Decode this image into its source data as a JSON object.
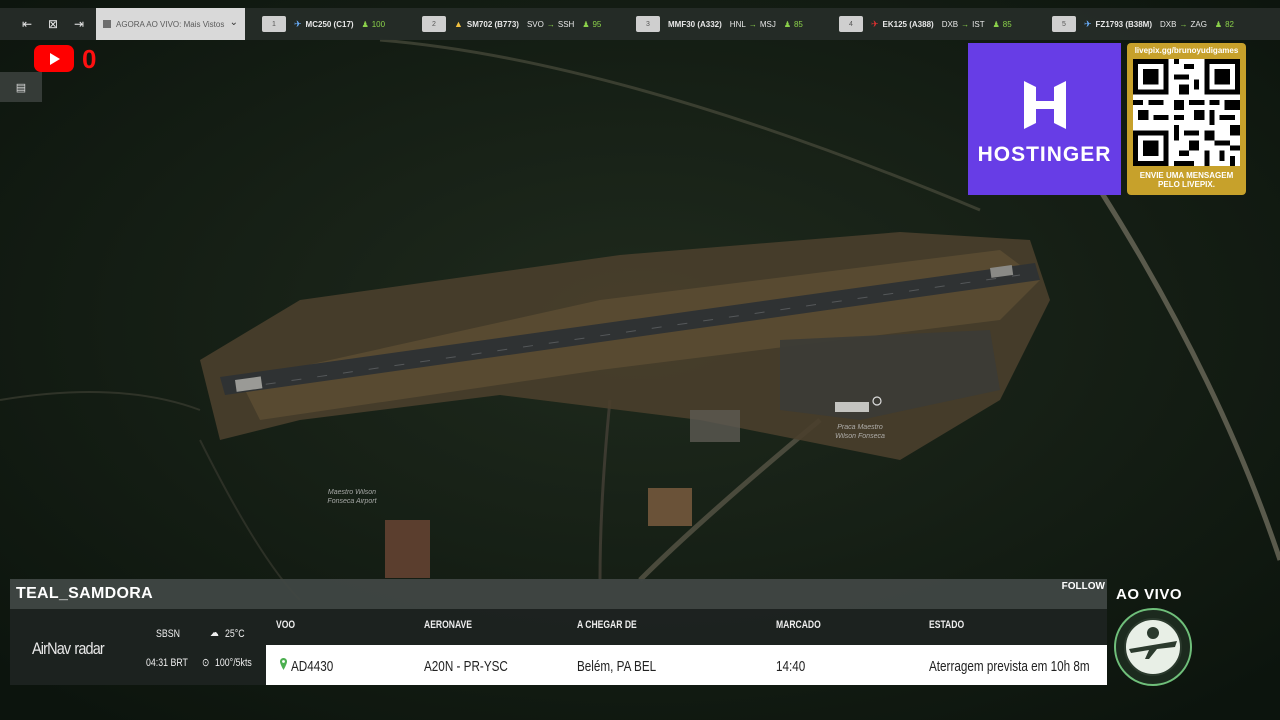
{
  "topbar": {
    "now_label": "AGORA AO VIVO: Mais Vistos",
    "flights": [
      {
        "rank": "1",
        "callsign": "MC250 (C17)",
        "route_from": "",
        "route_to": "",
        "score": "100"
      },
      {
        "rank": "2",
        "callsign": "SM702 (B773)",
        "route_from": "SVO",
        "route_to": "SSH",
        "score": "95"
      },
      {
        "rank": "3",
        "callsign": "MMF30 (A332)",
        "route_from": "HNL",
        "route_to": "MSJ",
        "score": "85"
      },
      {
        "rank": "4",
        "callsign": "EK125 (A388)",
        "route_from": "DXB",
        "route_to": "IST",
        "score": "85"
      },
      {
        "rank": "5",
        "callsign": "FZ1793 (B38M)",
        "route_from": "DXB",
        "route_to": "ZAG",
        "score": "82"
      }
    ]
  },
  "youtube": {
    "count": "0"
  },
  "map": {
    "airport_label_1": "Maestro Wilson",
    "airport_label_2": "Fonseca Airport",
    "plaza_label_1": "Praca Maestro",
    "plaza_label_2": "Wilson Fonseca"
  },
  "sponsor": {
    "name": "HOSTINGER",
    "qr_url": "livepix.gg/brunoyudigames",
    "qr_message_1": "ENVIE UMA MENSAGEM",
    "qr_message_2": "PELO LIVEPIX."
  },
  "panel": {
    "follow": "FOLLOW",
    "flight_name": "TEAL_SAMDORA",
    "brand_main": "AirNav",
    "brand_sub": "radar",
    "airport_code": "SBSN",
    "local_time": "04:31 BRT",
    "temperature": "25°C",
    "wind": "100°/5kts",
    "headers": {
      "flight": "VOO",
      "aircraft": "AERONAVE",
      "from": "A CHEGAR DE",
      "scheduled": "MARCADO",
      "status": "ESTADO"
    },
    "row": {
      "flight": "AD4430",
      "aircraft": "A20N - PR-YSC",
      "from": "Belém, PA BEL",
      "scheduled": "14:40",
      "status": "Aterragem prevista em 10h 8m"
    }
  },
  "live": {
    "label": "AO VIVO"
  },
  "colors": {
    "brand_purple": "#673de6",
    "qr_gold": "#c7a12b",
    "live_red": "#ff0000",
    "score_green": "#8bd14a"
  }
}
